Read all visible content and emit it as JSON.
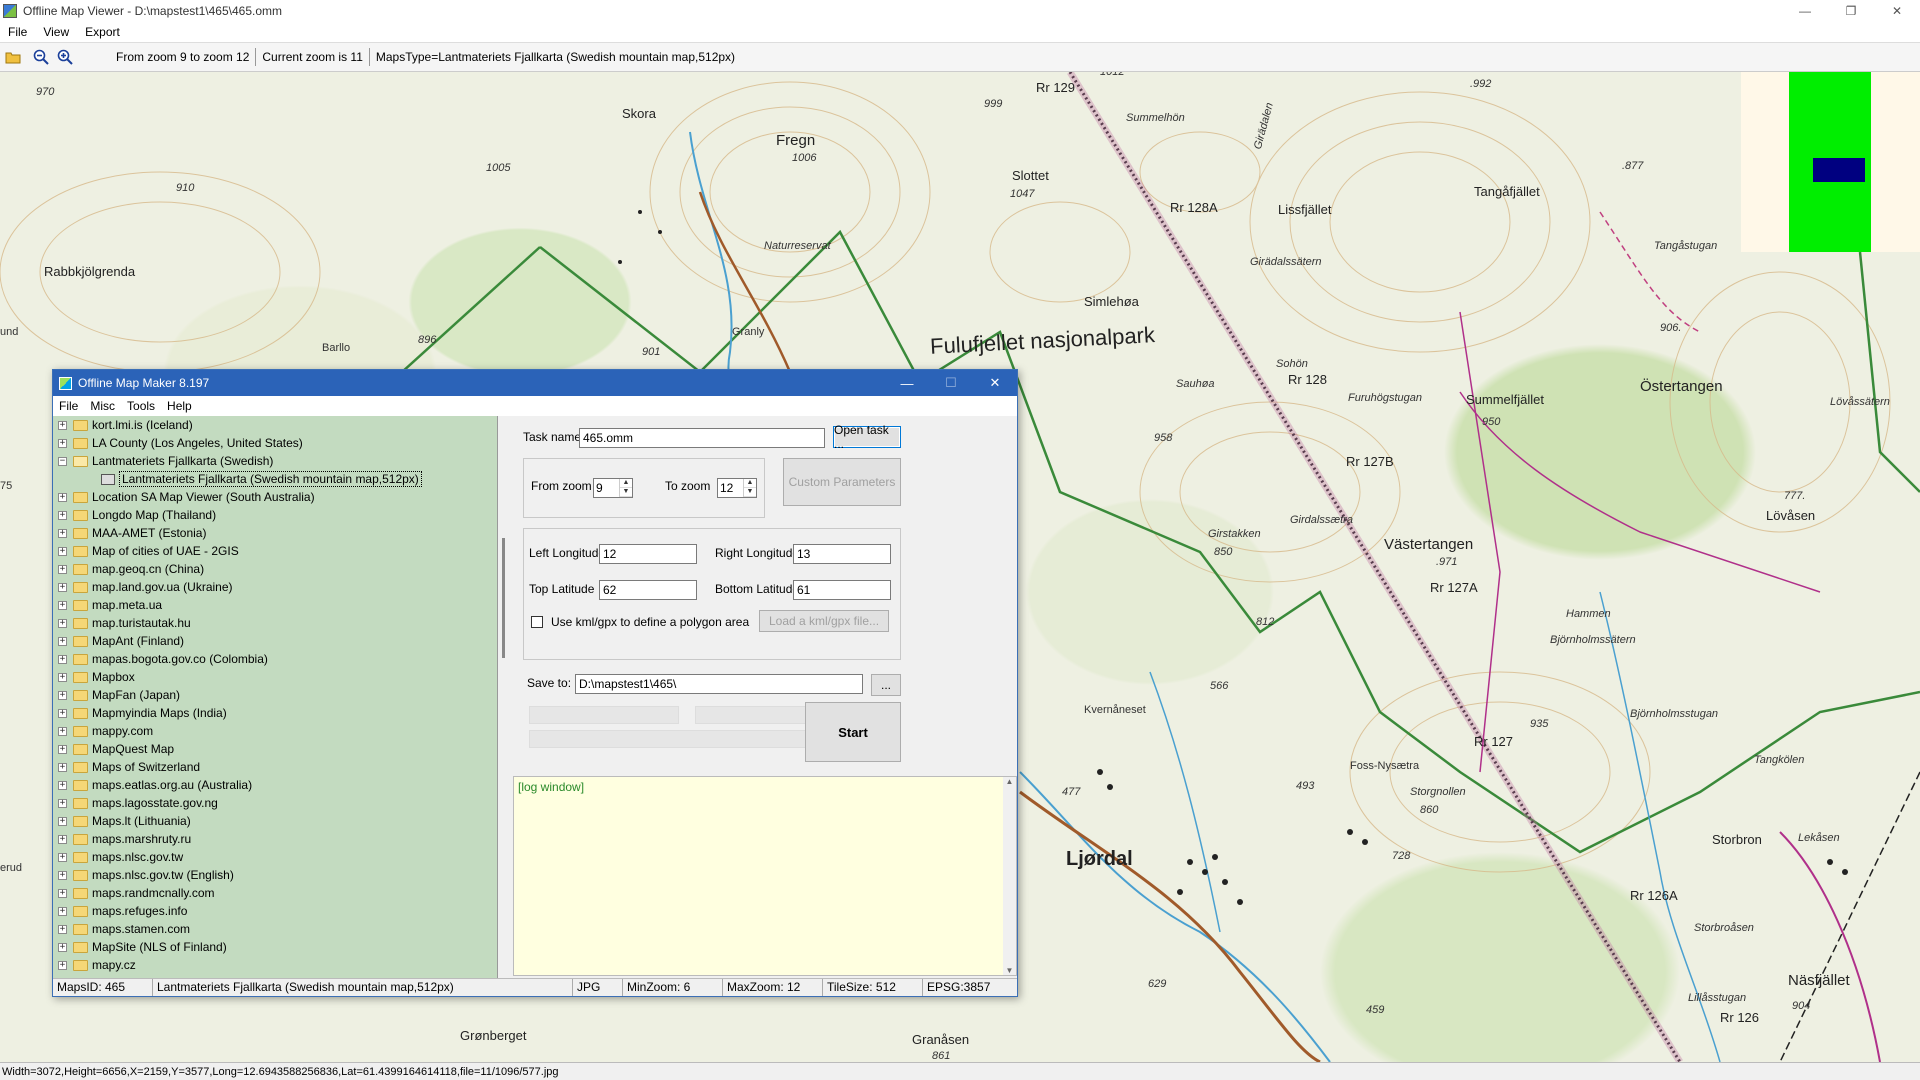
{
  "window": {
    "title": "Offline Map Viewer - D:\\mapstest1\\465\\465.omm",
    "controls": {
      "minimize": "—",
      "maximize": "❐",
      "close": "✕"
    }
  },
  "menubar": [
    "File",
    "View",
    "Export"
  ],
  "toolbar": {
    "icons": [
      "open-folder-icon",
      "zoom-out-icon",
      "zoom-in-icon"
    ],
    "zoom_range": "From zoom 9 to zoom 12",
    "current_zoom": "Current zoom is 11",
    "maps_type": "MapsType=Lantmateriets Fjallkarta (Swedish mountain map,512px)"
  },
  "map": {
    "labels": [
      {
        "text": "Skora",
        "cls": "place"
      },
      {
        "text": "Fregn",
        "cls": "place"
      },
      {
        "text": "1006",
        "cls": "small"
      },
      {
        "text": "Naturreservat",
        "cls": "small"
      },
      {
        "text": "999",
        "cls": "small"
      },
      {
        "text": "Rr 129",
        "cls": "place"
      },
      {
        "text": "1012",
        "cls": "small"
      },
      {
        "text": "Summelhön",
        "cls": "small"
      },
      {
        "text": "Girädalen",
        "cls": "small"
      },
      {
        "text": ".992",
        "cls": "small"
      },
      {
        "text": ".877",
        "cls": "small"
      },
      {
        "text": "Slottet",
        "cls": "place"
      },
      {
        "text": "1047",
        "cls": "small"
      },
      {
        "text": "Rr 128A",
        "cls": "place"
      },
      {
        "text": "Lissfjället",
        "cls": "place"
      },
      {
        "text": "Tangåfjället",
        "cls": "place"
      },
      {
        "text": "Tangåstugan",
        "cls": "small"
      },
      {
        "text": "Girädalssätern",
        "cls": "small"
      },
      {
        "text": "Simlehøa",
        "cls": "place"
      },
      {
        "text": "Fulufjellet nasjonalpark",
        "cls": "park"
      },
      {
        "text": "906.",
        "cls": "small"
      },
      {
        "text": "Östertangen",
        "cls": "place"
      },
      {
        "text": "Summelfjället",
        "cls": "place"
      },
      {
        "text": "950",
        "cls": "small"
      },
      {
        "text": "Lövåssätern",
        "cls": "small"
      },
      {
        "text": "Sohön",
        "cls": "small"
      },
      {
        "text": "Rr 128",
        "cls": "place"
      },
      {
        "text": "Sauhøa",
        "cls": "small"
      },
      {
        "text": "Furuhögstugan",
        "cls": "small"
      },
      {
        "text": "958",
        "cls": "small"
      },
      {
        "text": "Rr 127B",
        "cls": "place"
      },
      {
        "text": "777.",
        "cls": "small"
      },
      {
        "text": "Lövåsen",
        "cls": "place"
      },
      {
        "text": "Girdalssætra",
        "cls": "small"
      },
      {
        "text": "Girstakken",
        "cls": "small"
      },
      {
        "text": "850",
        "cls": "small"
      },
      {
        "text": "Västertangen",
        "cls": "place"
      },
      {
        "text": ".971",
        "cls": "small"
      },
      {
        "text": "Rr 127A",
        "cls": "place"
      },
      {
        "text": "Hammen",
        "cls": "small"
      },
      {
        "text": "812",
        "cls": "small"
      },
      {
        "text": "Björnholmssätern",
        "cls": "small"
      },
      {
        "text": "566",
        "cls": "small"
      },
      {
        "text": "Kvernåneset",
        "cls": "small"
      },
      {
        "text": "935",
        "cls": "small"
      },
      {
        "text": "Björnholmsstugan",
        "cls": "small"
      },
      {
        "text": "Rr 127",
        "cls": "place"
      },
      {
        "text": "Foss-Nysætra",
        "cls": "small"
      },
      {
        "text": "Tangkölen",
        "cls": "small"
      },
      {
        "text": "493",
        "cls": "small"
      },
      {
        "text": "Storgnollen",
        "cls": "small"
      },
      {
        "text": "860",
        "cls": "small"
      },
      {
        "text": "477",
        "cls": "small"
      },
      {
        "text": "Ljørdal",
        "cls": "town"
      },
      {
        "text": "728",
        "cls": "small"
      },
      {
        "text": "Storbron",
        "cls": "place"
      },
      {
        "text": "Lekåsen",
        "cls": "small"
      },
      {
        "text": "Rr 126A",
        "cls": "place"
      },
      {
        "text": "Storbroåsen",
        "cls": "small"
      },
      {
        "text": "Näsfjället",
        "cls": "place"
      },
      {
        "text": "Lillåsstugan",
        "cls": "small"
      },
      {
        "text": "904",
        "cls": "small"
      },
      {
        "text": "Rr 126",
        "cls": "place"
      },
      {
        "text": "629",
        "cls": "small"
      },
      {
        "text": "459",
        "cls": "small"
      },
      {
        "text": "Grønberget",
        "cls": "place"
      },
      {
        "text": "Granåsen",
        "cls": "place"
      },
      {
        "text": "861",
        "cls": "small"
      },
      {
        "text": "970",
        "cls": "small"
      },
      {
        "text": "910",
        "cls": "small"
      },
      {
        "text": "1005",
        "cls": "small"
      },
      {
        "text": "Rabbkjölgrenda",
        "cls": "place"
      },
      {
        "text": "896",
        "cls": "small"
      },
      {
        "text": "Barllo",
        "cls": "small"
      },
      {
        "text": "901",
        "cls": "small"
      },
      {
        "text": "Granly",
        "cls": "small"
      },
      {
        "text": "und",
        "cls": "small"
      },
      {
        "text": "75",
        "cls": "small"
      },
      {
        "text": "erud",
        "cls": "small"
      }
    ]
  },
  "statusbar": {
    "text": "Width=3072,Height=6656,X=2159,Y=3577,Long=12.6943588256836,Lat=61.4399164614118,file=11/1096/577.jpg"
  },
  "dialog": {
    "title": "Offline Map Maker 8.197",
    "controls": {
      "minimize": "—",
      "maximize": "☐",
      "close": "✕"
    },
    "menus": [
      "File",
      "Misc",
      "Tools",
      "Help"
    ],
    "tree": {
      "items": [
        {
          "label": "kort.lmi.is (Iceland)",
          "expander": "+",
          "type": "folder"
        },
        {
          "label": "LA County (Los Angeles, United States)",
          "expander": "+",
          "type": "folder"
        },
        {
          "label": "Lantmateriets Fjallkarta (Swedish)",
          "expander": "−",
          "type": "folder-open"
        },
        {
          "label": "Lantmateriets Fjallkarta (Swedish mountain map,512px)",
          "expander": "",
          "type": "leaf-selected"
        },
        {
          "label": "Location SA Map Viewer (South Australia)",
          "expander": "+",
          "type": "folder"
        },
        {
          "label": "Longdo Map (Thailand)",
          "expander": "+",
          "type": "folder"
        },
        {
          "label": "MAA-AMET (Estonia)",
          "expander": "+",
          "type": "folder"
        },
        {
          "label": "Map of cities of UAE - 2GIS",
          "expander": "+",
          "type": "folder"
        },
        {
          "label": "map.geoq.cn (China)",
          "expander": "+",
          "type": "folder"
        },
        {
          "label": "map.land.gov.ua (Ukraine)",
          "expander": "+",
          "type": "folder"
        },
        {
          "label": "map.meta.ua",
          "expander": "+",
          "type": "folder"
        },
        {
          "label": "map.turistautak.hu",
          "expander": "+",
          "type": "folder"
        },
        {
          "label": "MapAnt (Finland)",
          "expander": "+",
          "type": "folder"
        },
        {
          "label": "mapas.bogota.gov.co (Colombia)",
          "expander": "+",
          "type": "folder"
        },
        {
          "label": "Mapbox",
          "expander": "+",
          "type": "folder"
        },
        {
          "label": "MapFan (Japan)",
          "expander": "+",
          "type": "folder"
        },
        {
          "label": "Mapmyindia Maps (India)",
          "expander": "+",
          "type": "folder"
        },
        {
          "label": "mappy.com",
          "expander": "+",
          "type": "folder"
        },
        {
          "label": "MapQuest Map",
          "expander": "+",
          "type": "folder"
        },
        {
          "label": "Maps of Switzerland",
          "expander": "+",
          "type": "folder"
        },
        {
          "label": "maps.eatlas.org.au (Australia)",
          "expander": "+",
          "type": "folder"
        },
        {
          "label": "maps.lagosstate.gov.ng",
          "expander": "+",
          "type": "folder"
        },
        {
          "label": "Maps.lt (Lithuania)",
          "expander": "+",
          "type": "folder"
        },
        {
          "label": "maps.marshruty.ru",
          "expander": "+",
          "type": "folder"
        },
        {
          "label": "maps.nlsc.gov.tw",
          "expander": "+",
          "type": "folder"
        },
        {
          "label": "maps.nlsc.gov.tw (English)",
          "expander": "+",
          "type": "folder"
        },
        {
          "label": "maps.randmcnally.com",
          "expander": "+",
          "type": "folder"
        },
        {
          "label": "maps.refuges.info",
          "expander": "+",
          "type": "folder"
        },
        {
          "label": "maps.stamen.com",
          "expander": "+",
          "type": "folder"
        },
        {
          "label": "MapSite (NLS of Finland)",
          "expander": "+",
          "type": "folder"
        },
        {
          "label": "mapy.cz",
          "expander": "+",
          "type": "folder"
        }
      ]
    },
    "form": {
      "task_name_label": "Task name",
      "task_name_value": "465.omm",
      "open_task_button": "Open task ...",
      "from_zoom_label": "From zoom",
      "from_zoom_value": "9",
      "to_zoom_label": "To zoom",
      "to_zoom_value": "12",
      "custom_params_button": "Custom Parameters",
      "left_long_label": "Left Longitude",
      "left_long_value": "12",
      "right_long_label": "Right Longitude",
      "right_long_value": "13",
      "top_lat_label": "Top Latitude",
      "top_lat_value": "62",
      "bottom_lat_label": "Bottom Latitude",
      "bottom_lat_value": "61",
      "kml_checkbox_label": "Use kml/gpx to define a polygon area",
      "kml_checked": false,
      "load_kml_button": "Load a kml/gpx file...",
      "save_to_label": "Save to:",
      "save_to_value": "D:\\mapstest1\\465\\",
      "browse_button": "...",
      "start_button": "Start",
      "log_text": "[log window]"
    },
    "status": {
      "maps_id": "MapsID: 465",
      "map_name": "Lantmateriets Fjallkarta (Swedish mountain map,512px)",
      "format": "JPG",
      "min_zoom": "MinZoom: 6",
      "max_zoom": "MaxZoom: 12",
      "tile_size": "TileSize: 512",
      "epsg": "EPSG:3857"
    }
  }
}
